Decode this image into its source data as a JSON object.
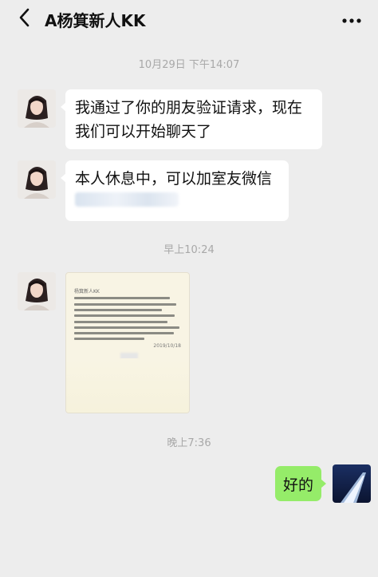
{
  "header": {
    "title": "A杨箕新人KK",
    "back_icon": "chevron-left-icon",
    "more_icon": "more-horizontal-icon"
  },
  "chat": {
    "timestamp_1": "10月29日 下午14:07",
    "message_1": "我通过了你的朋友验证请求，现在我们可以开始聊天了",
    "message_2": "本人休息中，可以加室友微信",
    "timestamp_2": "早上10:24",
    "image_caption": "杨箕新人KK",
    "image_date": "2019/10/18",
    "timestamp_3": "晚上7:36",
    "my_message": "好的"
  },
  "colors": {
    "background": "#ededed",
    "incoming_bubble": "#ffffff",
    "outgoing_bubble": "#95ec69",
    "timestamp": "#a8a8a8"
  }
}
